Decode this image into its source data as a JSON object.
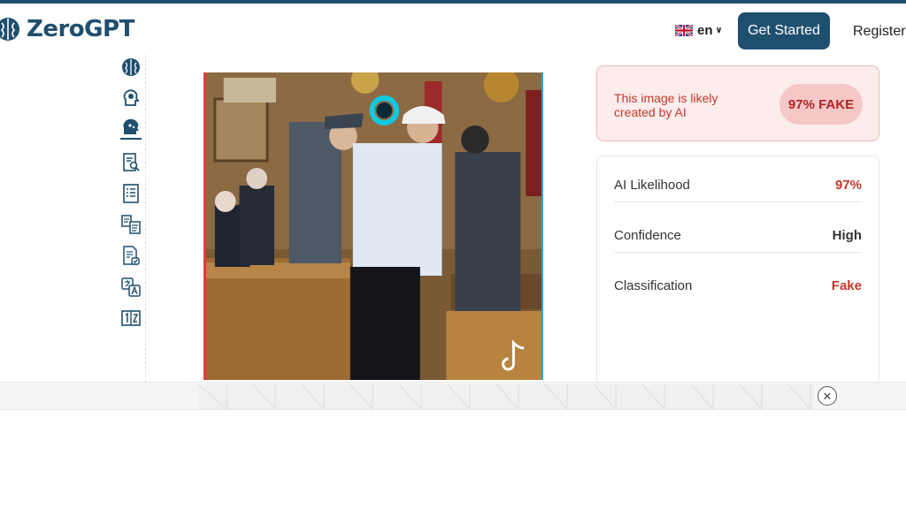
{
  "brand": {
    "name": "ZeroGPT",
    "logo_icon": "brain-icon"
  },
  "header": {
    "language": {
      "code": "en",
      "flag_icon": "uk-flag-icon"
    },
    "get_started_label": "Get Started",
    "register_label": "Register"
  },
  "sidebar": {
    "items": [
      {
        "icon": "brain-icon"
      },
      {
        "icon": "head-gear-icon"
      },
      {
        "icon": "face-scan-icon",
        "active": true
      },
      {
        "icon": "document-search-icon"
      },
      {
        "icon": "document-list-icon"
      },
      {
        "icon": "document-translate-icon"
      },
      {
        "icon": "document-check-icon"
      },
      {
        "icon": "translate-icon"
      },
      {
        "icon": "number-box-icon"
      }
    ]
  },
  "result": {
    "verdict_text": "This image is likely created by AI",
    "badge": "97% FAKE",
    "metrics": [
      {
        "label": "AI Likelihood",
        "value": "97%",
        "color": "#c0392b"
      },
      {
        "label": "Confidence",
        "value": "High",
        "color": "#333333"
      },
      {
        "label": "Classification",
        "value": "Fake",
        "color": "#c0392b"
      }
    ]
  },
  "colors": {
    "brand": "#1f4f6e",
    "fake": "#c0392b",
    "badge_bg": "#f6c7c7"
  }
}
